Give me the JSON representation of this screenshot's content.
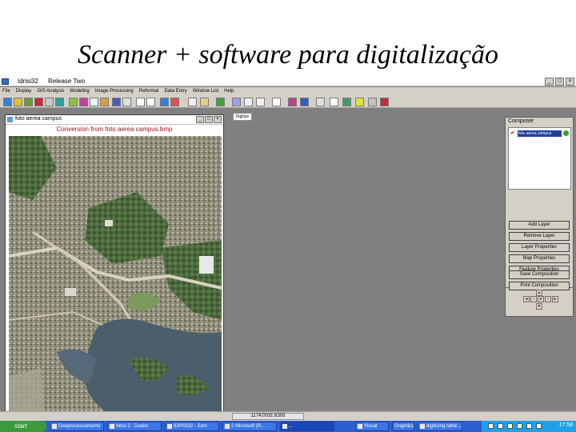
{
  "slide": {
    "title": "Scanner + software para digitalização"
  },
  "app": {
    "title": "Idrisi32",
    "subtitle": "Release Two",
    "menu": [
      "File",
      "Display",
      "GIS Analysis",
      "Modeling",
      "Image Processing",
      "Reformat",
      "Data Entry",
      "Window List",
      "Help"
    ]
  },
  "image_window": {
    "title": "foto aerea campus",
    "caption": "Conversion from foto aerea campus.bmp"
  },
  "digitize": {
    "label": "Digitize"
  },
  "composer": {
    "title": "Composer",
    "layer": "foto aerea campus",
    "buttons": [
      "Add Layer",
      "Remove Layer",
      "Layer Properties",
      "Map Properties",
      "Feature Properties",
      "Save Composition",
      "Print Composition"
    ]
  },
  "statusbar": {
    "coords": "1174:0031:6305"
  },
  "taskbar": {
    "start": "start",
    "tasks": [
      "Geoprocessamento",
      "Idrisi 2 - Dados",
      "IDRISI32 - Som",
      "2 Microsoft (R...",
      "...",
      "Visual",
      "Graphic1",
      "digitizing table ..."
    ],
    "clock": "17:58"
  },
  "colors": {
    "accent": "#1f3f9f",
    "caption_red": "#9b0f0f",
    "taskbar": "#2d5fd0"
  }
}
